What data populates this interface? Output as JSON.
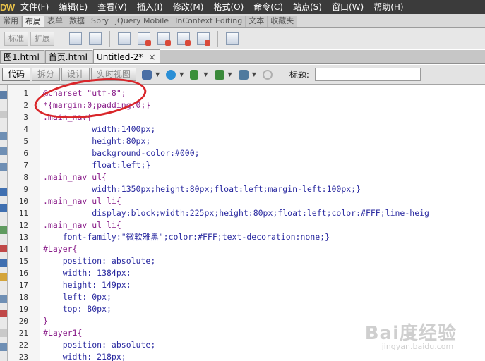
{
  "menubar": {
    "logo": "DW",
    "items": [
      "文件(F)",
      "编辑(E)",
      "查看(V)",
      "插入(I)",
      "修改(M)",
      "格式(O)",
      "命令(C)",
      "站点(S)",
      "窗口(W)",
      "帮助(H)"
    ]
  },
  "insert_tabs": [
    "常用",
    "布局",
    "表单",
    "数据",
    "Spry",
    "jQuery Mobile",
    "InContext Editing",
    "文本",
    "收藏夹"
  ],
  "insert_toolbar": {
    "buttons": [
      "标准",
      "扩展"
    ]
  },
  "document_tabs": [
    {
      "label": "图1.html",
      "active": false
    },
    {
      "label": "首页.html",
      "active": false
    },
    {
      "label": "Untitled-2*",
      "active": true,
      "close": "×"
    }
  ],
  "document_toolbar": {
    "views": [
      "代码",
      "拆分",
      "设计",
      "实时视图"
    ],
    "title_label": "标题:",
    "title_value": ""
  },
  "code": {
    "lines": [
      {
        "n": "1",
        "text": "@charset \"utf-8\";",
        "kind": "kw"
      },
      {
        "n": "2",
        "text": "*{margin:0;padding:0;}",
        "kind": "sel"
      },
      {
        "n": "3",
        "text": ".main_nav{",
        "kind": "sel"
      },
      {
        "n": "4",
        "text": "          width:1400px;",
        "kind": "prop"
      },
      {
        "n": "5",
        "text": "          height:80px;",
        "kind": "prop"
      },
      {
        "n": "6",
        "text": "          background-color:#000;",
        "kind": "prop"
      },
      {
        "n": "7",
        "text": "          float:left;}",
        "kind": "prop"
      },
      {
        "n": "8",
        "text": ".main_nav ul{",
        "kind": "sel"
      },
      {
        "n": "9",
        "text": "          width:1350px;height:80px;float:left;margin-left:100px;}",
        "kind": "prop"
      },
      {
        "n": "10",
        "text": ".main_nav ul li{",
        "kind": "sel"
      },
      {
        "n": "11",
        "text": "          display:block;width:225px;height:80px;float:left;color:#FFF;line-heig",
        "kind": "prop"
      },
      {
        "n": "12",
        "text": ".main_nav ul li{",
        "kind": "sel"
      },
      {
        "n": "13",
        "text": "    font-family:\"微软雅黑\";color:#FFF;text-decoration:none;}",
        "kind": "prop"
      },
      {
        "n": "14",
        "text": "#Layer{",
        "kind": "sel"
      },
      {
        "n": "15",
        "text": "    position: absolute;",
        "kind": "prop"
      },
      {
        "n": "16",
        "text": "    width: 1384px;",
        "kind": "prop"
      },
      {
        "n": "17",
        "text": "    height: 149px;",
        "kind": "prop"
      },
      {
        "n": "18",
        "text": "    left: 0px;",
        "kind": "prop"
      },
      {
        "n": "19",
        "text": "    top: 80px;",
        "kind": "prop"
      },
      {
        "n": "20",
        "text": "}",
        "kind": "sel"
      },
      {
        "n": "21",
        "text": "#Layer1{",
        "kind": "sel"
      },
      {
        "n": "22",
        "text": "    position: absolute;",
        "kind": "prop"
      },
      {
        "n": "23",
        "text": "    width: 218px;",
        "kind": "prop"
      }
    ]
  },
  "watermark": {
    "brand": "Bai度经验",
    "url": "jingyan.baidu.com"
  },
  "colors": {
    "annotation_circle": "#d9262a",
    "menubar_bg": "#3b3b3b"
  }
}
